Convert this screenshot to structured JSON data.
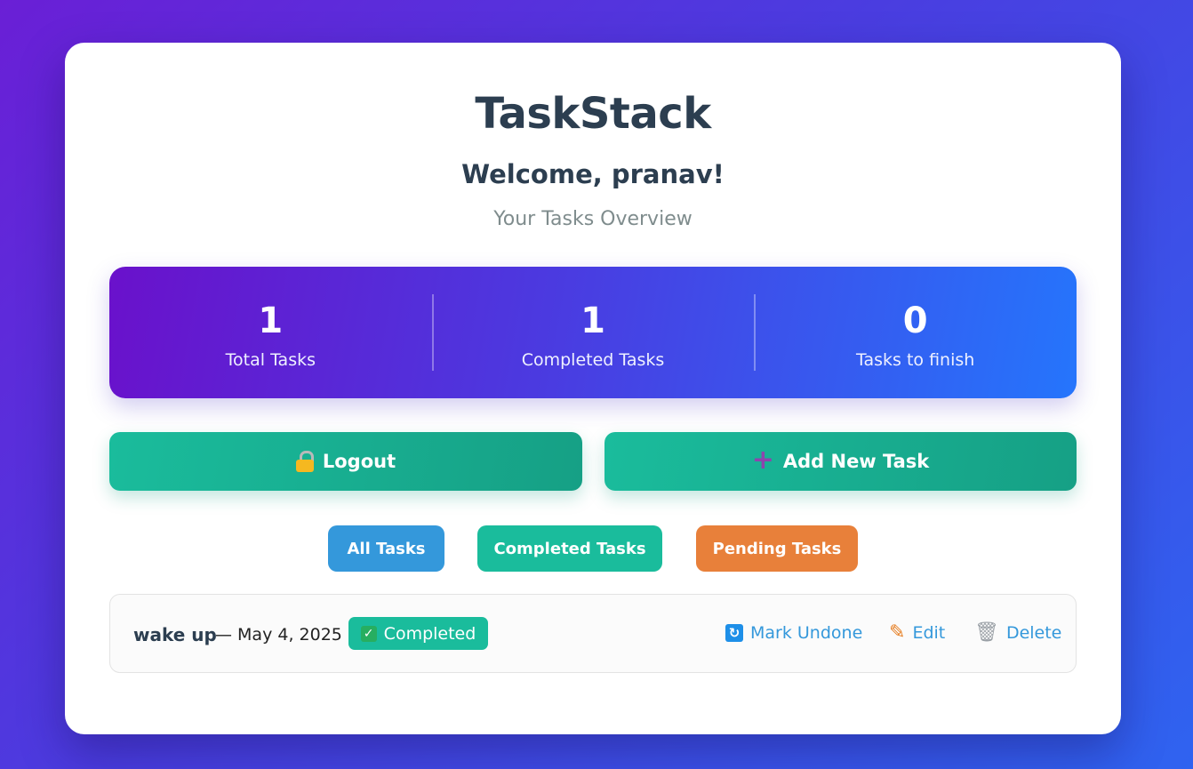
{
  "app": {
    "title": "TaskStack",
    "welcome": "Welcome, pranav!",
    "subtitle": "Your Tasks Overview"
  },
  "stats": [
    {
      "value": "1",
      "label": "Total Tasks"
    },
    {
      "value": "1",
      "label": "Completed Tasks"
    },
    {
      "value": "0",
      "label": "Tasks to finish"
    }
  ],
  "actions": {
    "logout_label": "Logout",
    "add_label": "Add New Task"
  },
  "filters": {
    "all": "All Tasks",
    "completed": "Completed Tasks",
    "pending": "Pending Tasks"
  },
  "tasks": [
    {
      "title": "wake up",
      "date": "— May 4, 2025",
      "status": "Completed",
      "mark_label": "Mark Undone",
      "edit_label": "Edit",
      "delete_label": "Delete"
    }
  ],
  "icons": {
    "logout": "lock-icon",
    "add": "plus-icon",
    "status": "checkmark-icon",
    "mark": "refresh-icon",
    "edit": "pencil-icon",
    "delete": "trash-icon"
  },
  "colors": {
    "accent_teal": "#1abc9c",
    "filter_all": "#3498db",
    "filter_pending": "#e8803a",
    "link": "#3498db",
    "heading": "#2c3e50"
  }
}
